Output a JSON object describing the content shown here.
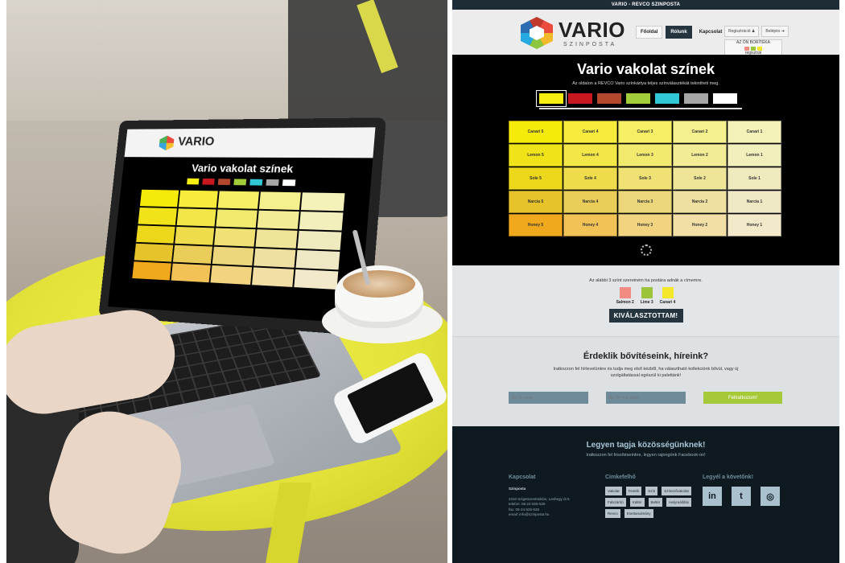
{
  "site": {
    "topbar": "VARIO - REVCO SZINPOSTA",
    "brand": "VARIO",
    "brand_sub": "SZINPOSTA",
    "nav": [
      "Főoldal",
      "Rólunk",
      "Kapcsolat"
    ],
    "auth": [
      "Regisztráció",
      "Belépés"
    ],
    "envelope_label": "AZ ÖN BORÍTÉKA",
    "envelope_sub": "regisztrál",
    "hero_title": "Vario vakolat színek",
    "hero_sub": "Az oldalon a REVCO Vario színkártya teljes színválasztékát tekintheti meg.",
    "swatches": [
      "#f5ee10",
      "#c8181f",
      "#b2472d",
      "#a3cc3a",
      "#31c7d4",
      "#a6a6a6",
      "#ffffff"
    ],
    "grid": [
      [
        {
          "label": "Canari 5",
          "color": "#f6ea0a"
        },
        {
          "label": "Canari 4",
          "color": "#f7ec3c"
        },
        {
          "label": "Canari 3",
          "color": "#f6ee64"
        },
        {
          "label": "Canari 2",
          "color": "#f5f08e"
        },
        {
          "label": "Canari 1",
          "color": "#f4f2b8"
        }
      ],
      [
        {
          "label": "Lemon 5",
          "color": "#f1e319"
        },
        {
          "label": "Lemon 4",
          "color": "#f2e648"
        },
        {
          "label": "Lemon 3",
          "color": "#f2e96f"
        },
        {
          "label": "Lemon 2",
          "color": "#f1ec95"
        },
        {
          "label": "Lemon 1",
          "color": "#f1efbc"
        }
      ],
      [
        {
          "label": "Sole 5",
          "color": "#ecd71a"
        },
        {
          "label": "Sole 4",
          "color": "#eedc4c"
        },
        {
          "label": "Sole 3",
          "color": "#efe173"
        },
        {
          "label": "Sole 2",
          "color": "#efe598"
        },
        {
          "label": "Sole 1",
          "color": "#efeabe"
        }
      ],
      [
        {
          "label": "Narcia 5",
          "color": "#e6c32b"
        },
        {
          "label": "Narcia 4",
          "color": "#e9cd58"
        },
        {
          "label": "Narcia 3",
          "color": "#ebd67c"
        },
        {
          "label": "Narcia 2",
          "color": "#ede0a0"
        },
        {
          "label": "Narcia 1",
          "color": "#efe8c4"
        }
      ],
      [
        {
          "label": "Honey 5",
          "color": "#f0a91c"
        },
        {
          "label": "Honey 4",
          "color": "#f2c257"
        },
        {
          "label": "Honey 3",
          "color": "#f2d37f"
        },
        {
          "label": "Honey 2",
          "color": "#f1dfa6"
        },
        {
          "label": "Honey 1",
          "color": "#f1e9c9"
        }
      ]
    ],
    "pick_text": "Az alábbi 3 színt szeretném ha postára adnák a címemre.",
    "picked": [
      {
        "label": "Salmon 2",
        "color": "#f28b82"
      },
      {
        "label": "Lime 3",
        "color": "#9bc43a"
      },
      {
        "label": "Canari 4",
        "color": "#f5e82a"
      }
    ],
    "pick_button": "KIVÁLASZTOTTAM!",
    "news_title": "Érdeklik bővítéseink, híreink?",
    "news_desc": "Iratkozzon fel hírlevelünkre és tudja meg első kézből, ha választható kollekciónk bővül, vagy új szolgáltatással egészül ki palettánk!",
    "name_placeholder": "Az Ön neve",
    "email_placeholder": "Az Ön mail címe",
    "subscribe": "Feliratkozom!",
    "footer_title": "Legyen tagja közösségünknek!",
    "footer_sub": "Iratkozzon fel frissítéseinkre, legyen rajongónk Facebook-on!",
    "contact_title": "Kapcsolat",
    "contact_company": "Szinposta",
    "contact_lines": [
      "2310 Szigetszentmiklós, Leshegy út 5.",
      "",
      "telefon: 06-24-525-525",
      "fax: 06-24-525-526",
      "email: info@szinposta.hu"
    ],
    "tags_title": "Cimkefelhő",
    "tags": [
      "Vakolat",
      "Festék",
      "Szín",
      "Színezővakolat",
      "Falszárító",
      "Kültér",
      "Beltér",
      "Helyreállítás",
      "Revco",
      "Esettanulmány"
    ],
    "social_title": "Legyél a követőnk!",
    "social": [
      {
        "name": "linkedin-icon",
        "glyph": "in"
      },
      {
        "name": "twitter-icon",
        "glyph": "t"
      },
      {
        "name": "instagram-icon",
        "glyph": "◎"
      }
    ]
  },
  "photo": {
    "laptop_brand": "VARIO",
    "laptop_title": "Vario vakolat színek"
  }
}
